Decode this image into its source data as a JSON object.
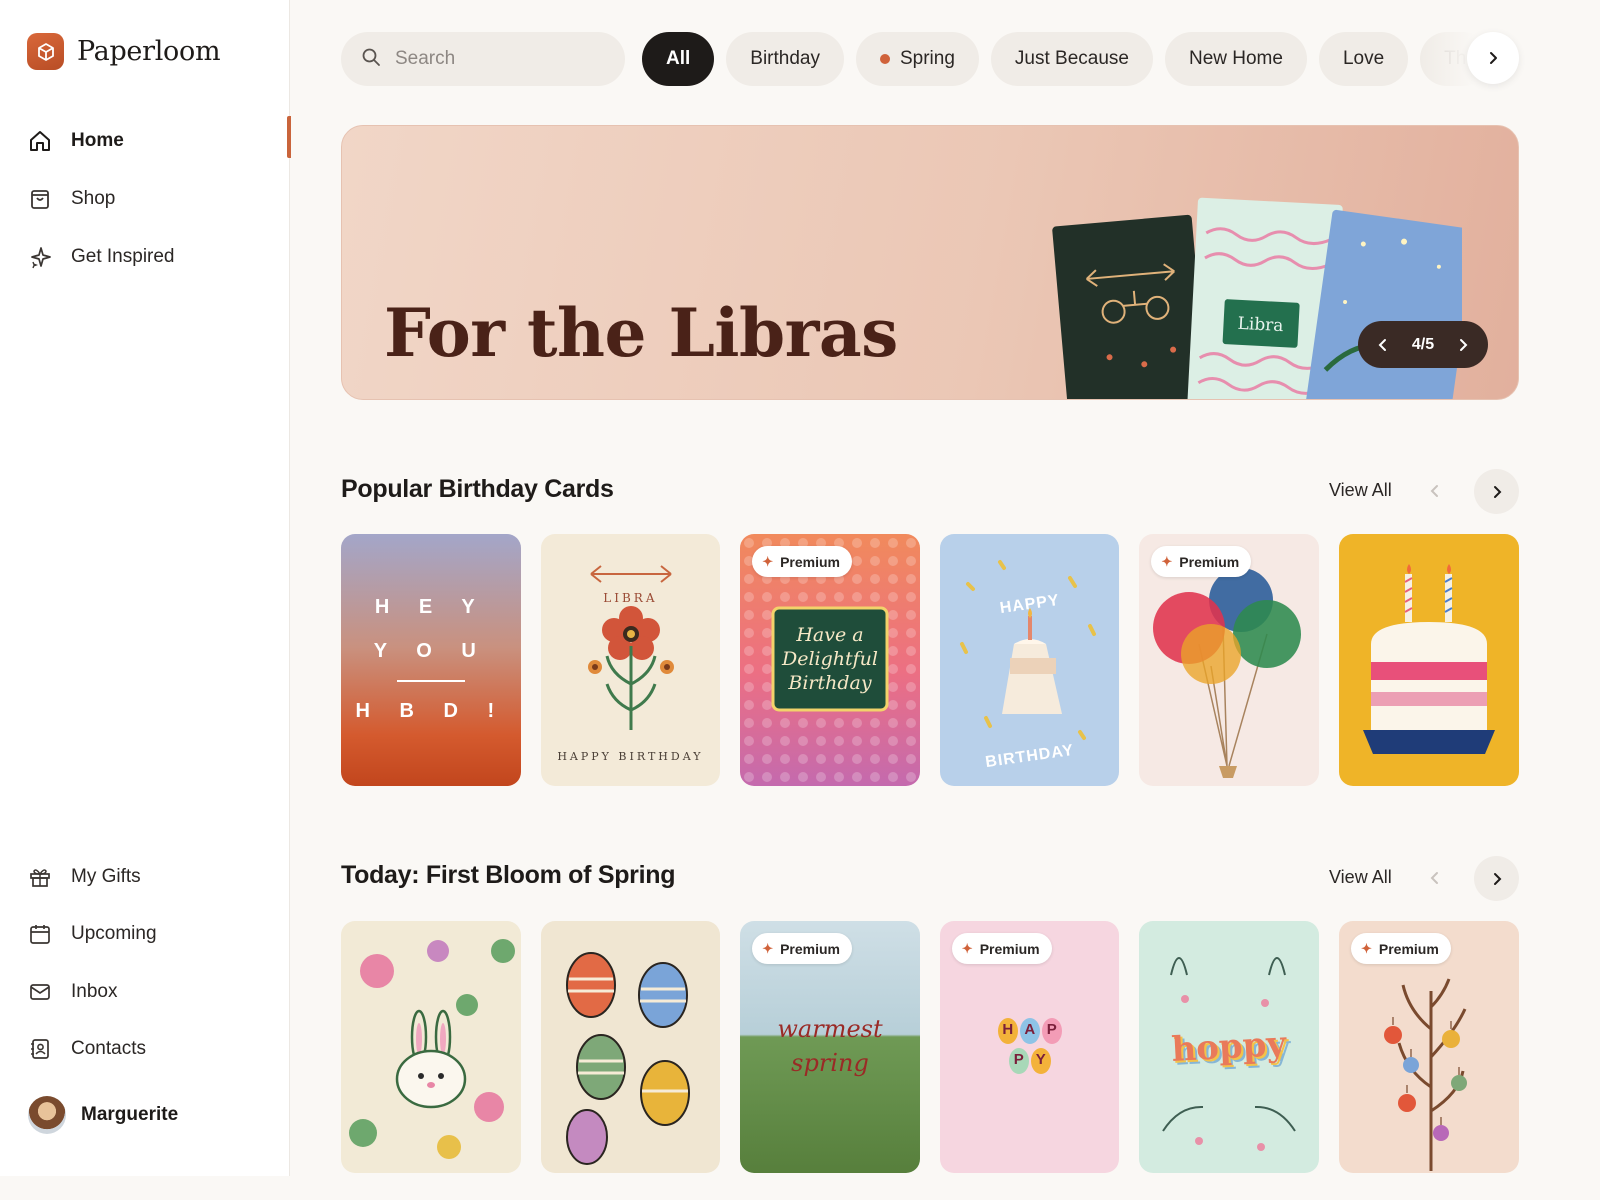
{
  "app": {
    "name": "Paperloom"
  },
  "nav_top": [
    {
      "label": "Home",
      "icon": "home-icon",
      "active": true
    },
    {
      "label": "Shop",
      "icon": "shopping-bag-icon"
    },
    {
      "label": "Get Inspired",
      "icon": "sparkles-icon"
    }
  ],
  "nav_bottom": [
    {
      "label": "My Gifts",
      "icon": "gift-icon"
    },
    {
      "label": "Upcoming",
      "icon": "calendar-icon"
    },
    {
      "label": "Inbox",
      "icon": "mail-icon"
    },
    {
      "label": "Contacts",
      "icon": "contacts-icon"
    }
  ],
  "user": {
    "name": "Marguerite"
  },
  "search": {
    "placeholder": "Search"
  },
  "chips": [
    "All",
    "Birthday",
    "Spring",
    "Just Because",
    "New Home",
    "Love",
    "Th"
  ],
  "banner": {
    "title": "For the Libras",
    "card_label": "Libra",
    "pager": "4/5"
  },
  "section_birthday": {
    "title": "Popular Birthday Cards",
    "view_all": "View All",
    "badge": "Premium",
    "card1": {
      "line1": "H E Y",
      "line2": "Y O U",
      "line3": "H B D !"
    },
    "card2": {
      "top": "LIBRA",
      "bottom": "HAPPY BIRTHDAY"
    },
    "card3": {
      "l1": "Have a",
      "l2": "Delightful",
      "l3": "Birthday"
    },
    "card4": {
      "top": "HAPPY",
      "bottom": "BIRTHDAY"
    }
  },
  "section_spring": {
    "title": "Today: First Bloom of Spring",
    "view_all": "View All",
    "badge": "Premium",
    "card3": {
      "l1": "warmest",
      "l2": "spring"
    },
    "card4": {
      "letters": [
        "H",
        "A",
        "P",
        "P",
        "Y"
      ]
    },
    "card5": {
      "word": "hoppy"
    }
  },
  "colors": {
    "accent": "#c9643b",
    "dark": "#1e1b19",
    "banner_title": "#4a2218"
  }
}
